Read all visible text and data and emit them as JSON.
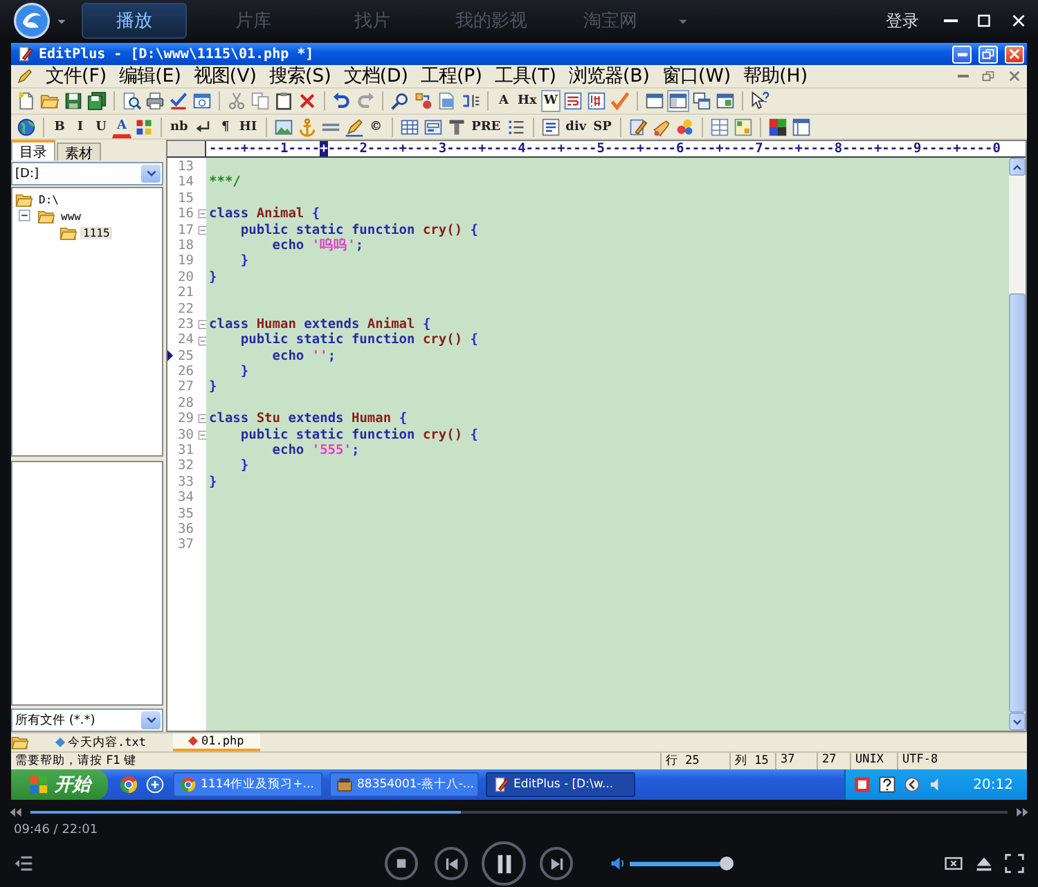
{
  "player_bar": {
    "tabs": [
      {
        "label": "播放",
        "selected": true
      },
      {
        "label": "片库",
        "selected": false
      },
      {
        "label": "找片",
        "selected": false
      },
      {
        "label": "我的影视",
        "selected": false
      },
      {
        "label": "淘宝网",
        "selected": false
      }
    ],
    "login": "登录"
  },
  "editor_window": {
    "title": "EditPlus - [D:\\www\\1115\\01.php *]",
    "menu": [
      "文件(F)",
      "编辑(E)",
      "视图(V)",
      "搜索(S)",
      "文档(D)",
      "工程(P)",
      "工具(T)",
      "浏览器(B)",
      "窗口(W)",
      "帮助(H)"
    ],
    "toolbars": [
      [
        {
          "kind": "icon",
          "pressed": false
        },
        {
          "kind": "icon",
          "pressed": false
        },
        {
          "kind": "icon",
          "pressed": false
        },
        {
          "kind": "icon",
          "pressed": false
        },
        {
          "kind": "separator"
        },
        {
          "kind": "icon",
          "pressed": false
        },
        {
          "kind": "icon",
          "pressed": false
        },
        {
          "kind": "icon",
          "pressed": false
        },
        {
          "kind": "icon",
          "pressed": false
        },
        {
          "kind": "separator"
        },
        {
          "kind": "icon",
          "pressed": false
        },
        {
          "kind": "icon",
          "pressed": false
        },
        {
          "kind": "icon",
          "pressed": false
        },
        {
          "kind": "icon",
          "pressed": false
        },
        {
          "kind": "separator"
        },
        {
          "kind": "icon",
          "pressed": false
        },
        {
          "kind": "icon",
          "pressed": false
        },
        {
          "kind": "separator"
        },
        {
          "kind": "icon",
          "pressed": false
        },
        {
          "kind": "icon",
          "pressed": false
        },
        {
          "kind": "icon",
          "pressed": false
        },
        {
          "kind": "icon",
          "pressed": false
        },
        {
          "kind": "separator"
        },
        {
          "kind": "text",
          "label": "A",
          "pressed": false
        },
        {
          "kind": "text",
          "label": "Hx",
          "pressed": false
        },
        {
          "kind": "text",
          "label": "W",
          "pressed": true
        },
        {
          "kind": "icon",
          "pressed": false
        },
        {
          "kind": "icon",
          "pressed": false
        },
        {
          "kind": "icon",
          "pressed": false
        },
        {
          "kind": "separator"
        },
        {
          "kind": "icon",
          "pressed": false
        },
        {
          "kind": "icon",
          "pressed": true
        },
        {
          "kind": "icon",
          "pressed": false
        },
        {
          "kind": "icon",
          "pressed": false
        },
        {
          "kind": "separator"
        },
        {
          "kind": "icon",
          "pressed": false
        }
      ],
      [
        {
          "kind": "icon",
          "pressed": false
        },
        {
          "kind": "separator"
        },
        {
          "kind": "text",
          "label": "B",
          "pressed": false
        },
        {
          "kind": "text",
          "label": "I",
          "pressed": false
        },
        {
          "kind": "text",
          "label": "U",
          "pressed": false
        },
        {
          "kind": "color-text",
          "label": "A",
          "pressed": false
        },
        {
          "kind": "icon",
          "pressed": false
        },
        {
          "kind": "separator"
        },
        {
          "kind": "text",
          "label": "nb",
          "pressed": false
        },
        {
          "kind": "icon",
          "pressed": false
        },
        {
          "kind": "text",
          "label": "¶",
          "pressed": false
        },
        {
          "kind": "text",
          "label": "HI",
          "pressed": false
        },
        {
          "kind": "separator"
        },
        {
          "kind": "icon",
          "pressed": false
        },
        {
          "kind": "icon",
          "pressed": false
        },
        {
          "kind": "icon",
          "pressed": false
        },
        {
          "kind": "icon",
          "pressed": false
        },
        {
          "kind": "text",
          "label": "©",
          "pressed": false
        },
        {
          "kind": "separator"
        },
        {
          "kind": "icon",
          "pressed": false
        },
        {
          "kind": "icon",
          "pressed": false
        },
        {
          "kind": "icon",
          "pressed": false
        },
        {
          "kind": "text",
          "label": "PRE",
          "pressed": false
        },
        {
          "kind": "icon",
          "pressed": false
        },
        {
          "kind": "separator"
        },
        {
          "kind": "icon",
          "pressed": false
        },
        {
          "kind": "text",
          "label": "div",
          "pressed": false
        },
        {
          "kind": "text",
          "label": "SP",
          "pressed": false
        },
        {
          "kind": "separator"
        },
        {
          "kind": "icon",
          "pressed": false
        },
        {
          "kind": "icon",
          "pressed": false
        },
        {
          "kind": "icon",
          "pressed": false
        },
        {
          "kind": "separator"
        },
        {
          "kind": "icon",
          "pressed": false
        },
        {
          "kind": "icon",
          "pressed": false
        },
        {
          "kind": "separator"
        },
        {
          "kind": "icon",
          "pressed": false
        },
        {
          "kind": "icon",
          "pressed": false
        }
      ]
    ],
    "side_panel": {
      "tabs": [
        {
          "label": "目录",
          "selected": true
        },
        {
          "label": "素材",
          "selected": false
        }
      ],
      "drive": "[D:]",
      "tree": [
        {
          "label": "D:\\",
          "selected": false,
          "children": [
            {
              "label": "www",
              "expanded": true,
              "selected": false,
              "children": [
                {
                  "label": "1115",
                  "selected": true
                }
              ]
            }
          ]
        }
      ],
      "filter": "所有文件 (*.*)"
    },
    "ruler": [
      {
        "text": "----+----1----",
        "selected": false
      },
      {
        "text": "+",
        "selected": true
      },
      {
        "text": "----2----+----3----+----4----+----5----+----6----+----7----+----8----+----9----+----0",
        "selected": false
      }
    ],
    "lines": [
      {
        "number": "13",
        "fold": false,
        "current": false
      },
      {
        "number": "14",
        "fold": false,
        "current": false,
        "tokens": [
          {
            "kind": "comment",
            "text": "***/"
          }
        ]
      },
      {
        "number": "15",
        "fold": false,
        "current": false
      },
      {
        "number": "16",
        "fold": true,
        "current": false,
        "tokens": [
          {
            "kind": "keyword",
            "text": "class "
          },
          {
            "kind": "name",
            "text": "Animal "
          },
          {
            "kind": "punct",
            "text": "{"
          }
        ]
      },
      {
        "number": "17",
        "fold": true,
        "current": false,
        "tokens": [
          {
            "kind": "keyword",
            "text": "    public static function "
          },
          {
            "kind": "name",
            "text": "cry() "
          },
          {
            "kind": "punct",
            "text": "{"
          }
        ]
      },
      {
        "number": "18",
        "fold": false,
        "current": false,
        "tokens": [
          {
            "kind": "keyword",
            "text": "        echo "
          },
          {
            "kind": "string",
            "text": "'呜呜'"
          },
          {
            "kind": "punct",
            "text": ";"
          }
        ]
      },
      {
        "number": "19",
        "fold": false,
        "current": false,
        "tokens": [
          {
            "kind": "punct",
            "text": "    }"
          }
        ]
      },
      {
        "number": "20",
        "fold": false,
        "current": false,
        "tokens": [
          {
            "kind": "punct",
            "text": "}"
          }
        ]
      },
      {
        "number": "21",
        "fold": false,
        "current": false
      },
      {
        "number": "22",
        "fold": false,
        "current": false
      },
      {
        "number": "23",
        "fold": true,
        "current": false,
        "tokens": [
          {
            "kind": "keyword",
            "text": "class "
          },
          {
            "kind": "name",
            "text": "Human "
          },
          {
            "kind": "keyword",
            "text": "extends "
          },
          {
            "kind": "name",
            "text": "Animal "
          },
          {
            "kind": "punct",
            "text": "{"
          }
        ]
      },
      {
        "number": "24",
        "fold": true,
        "current": false,
        "tokens": [
          {
            "kind": "keyword",
            "text": "    public static function "
          },
          {
            "kind": "name",
            "text": "cry() "
          },
          {
            "kind": "punct",
            "text": "{"
          }
        ]
      },
      {
        "number": "25",
        "fold": false,
        "current": true,
        "tokens": [
          {
            "kind": "keyword",
            "text": "        echo "
          },
          {
            "kind": "string",
            "text": "''"
          },
          {
            "kind": "punct",
            "text": ";"
          }
        ]
      },
      {
        "number": "26",
        "fold": false,
        "current": false,
        "tokens": [
          {
            "kind": "punct",
            "text": "    }"
          }
        ]
      },
      {
        "number": "27",
        "fold": false,
        "current": false,
        "tokens": [
          {
            "kind": "punct",
            "text": "}"
          }
        ]
      },
      {
        "number": "28",
        "fold": false,
        "current": false
      },
      {
        "number": "29",
        "fold": true,
        "current": false,
        "tokens": [
          {
            "kind": "keyword",
            "text": "class "
          },
          {
            "kind": "name",
            "text": "Stu "
          },
          {
            "kind": "keyword",
            "text": "extends "
          },
          {
            "kind": "name",
            "text": "Human "
          },
          {
            "kind": "punct",
            "text": "{"
          }
        ]
      },
      {
        "number": "30",
        "fold": true,
        "current": false,
        "tokens": [
          {
            "kind": "keyword",
            "text": "    public static function "
          },
          {
            "kind": "name",
            "text": "cry() "
          },
          {
            "kind": "punct",
            "text": "{"
          }
        ]
      },
      {
        "number": "31",
        "fold": false,
        "current": false,
        "tokens": [
          {
            "kind": "keyword",
            "text": "        echo "
          },
          {
            "kind": "string",
            "text": "'555'"
          },
          {
            "kind": "punct",
            "text": ";"
          }
        ]
      },
      {
        "number": "32",
        "fold": false,
        "current": false,
        "tokens": [
          {
            "kind": "punct",
            "text": "    }"
          }
        ]
      },
      {
        "number": "33",
        "fold": false,
        "current": false,
        "tokens": [
          {
            "kind": "punct",
            "text": "}"
          }
        ]
      },
      {
        "number": "34",
        "fold": false,
        "current": false
      },
      {
        "number": "35",
        "fold": false,
        "current": false
      },
      {
        "number": "36",
        "fold": false,
        "current": false
      },
      {
        "number": "37",
        "fold": false,
        "current": false
      }
    ],
    "document_tabs": [
      {
        "label": "今天内容.txt",
        "selected": false,
        "color": "#3a8fd0"
      },
      {
        "label": "01.php",
        "selected": true,
        "color": "#d04030"
      }
    ],
    "status_bar": {
      "help": "需要帮助，请按 F1 键",
      "cells": [
        "行 25",
        "列 15",
        "37",
        "27",
        "UNIX",
        "UTF-8"
      ]
    }
  },
  "taskbar": {
    "start": "开始",
    "tasks": [
      {
        "label": "1114作业及预习+...",
        "selected": false
      },
      {
        "label": "88354001-燕十八-...",
        "selected": false
      },
      {
        "label": "EditPlus - [D:\\w...",
        "selected": true
      }
    ],
    "clock": "20:12"
  },
  "player_controls": {
    "progress": {
      "level": 0.44
    },
    "time": "09:46 / 22:01",
    "volume": {
      "level": 1
    }
  }
}
